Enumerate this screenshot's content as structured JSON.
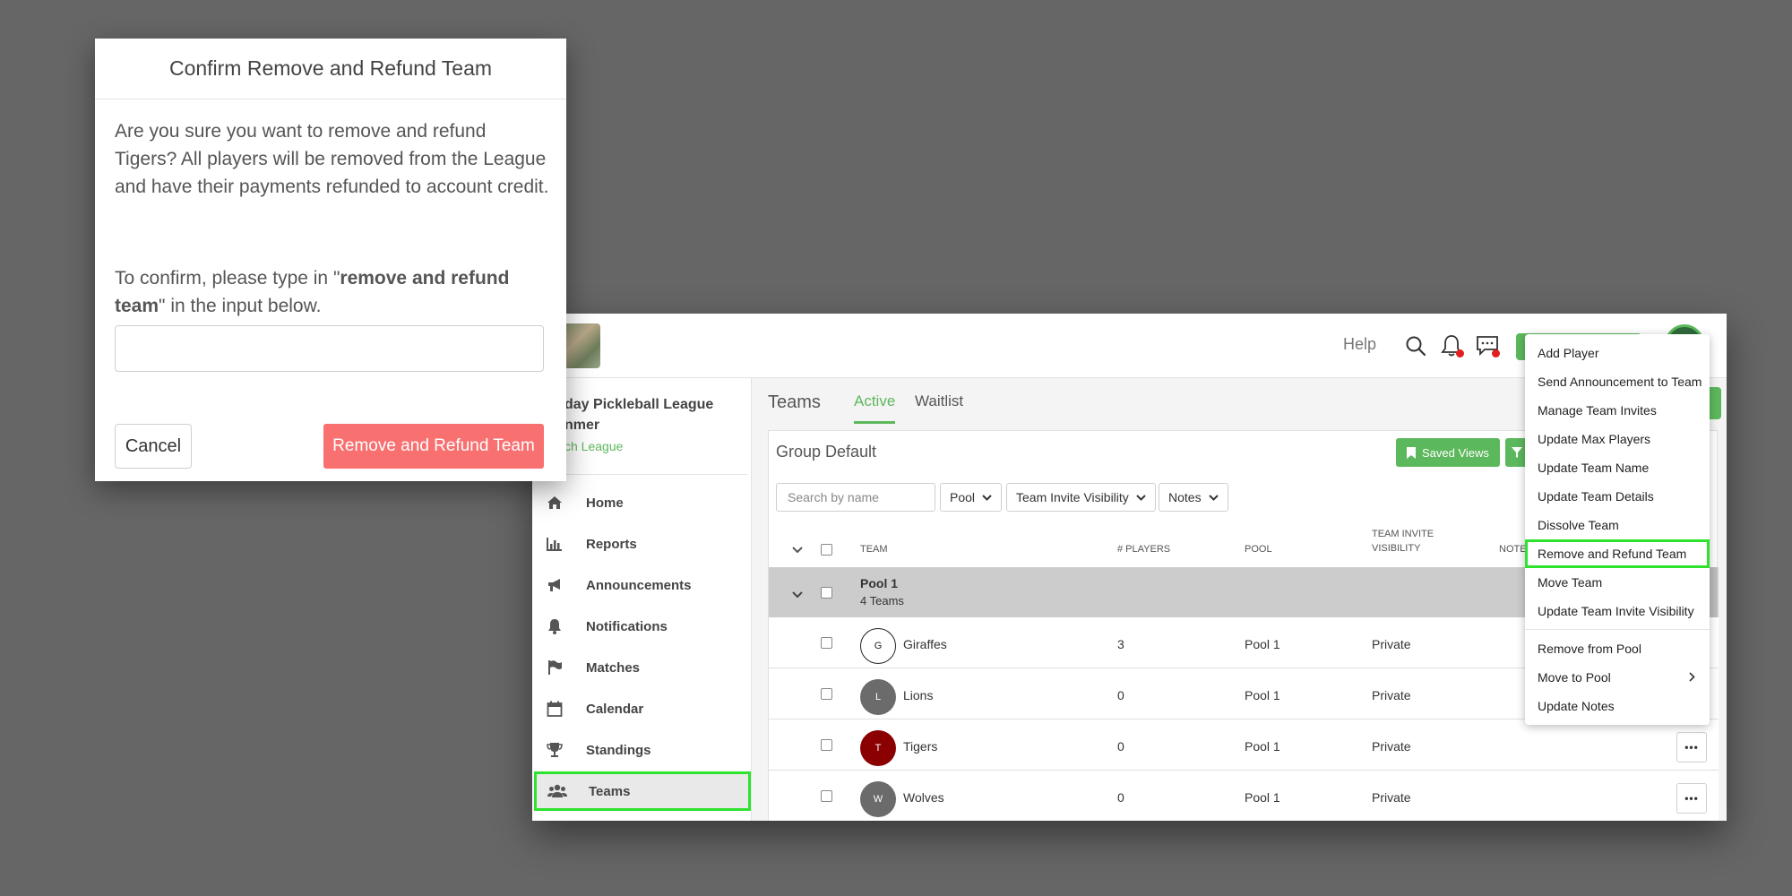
{
  "topbar": {
    "help_label": "Help",
    "icons": [
      "search-icon",
      "bell-icon",
      "chat-icon"
    ],
    "notification_dot_color": "#e02020"
  },
  "sidebar": {
    "league_name_line1": "day Pickleball League",
    "league_name_line2": "nmer",
    "league_link": "ch League",
    "items": [
      {
        "label": "Home",
        "icon": "home-icon"
      },
      {
        "label": "Reports",
        "icon": "bar-chart-icon"
      },
      {
        "label": "Announcements",
        "icon": "megaphone-icon"
      },
      {
        "label": "Notifications",
        "icon": "bell-icon"
      },
      {
        "label": "Matches",
        "icon": "flag-icon"
      },
      {
        "label": "Calendar",
        "icon": "calendar-icon"
      },
      {
        "label": "Standings",
        "icon": "trophy-icon"
      },
      {
        "label": "Teams",
        "icon": "users-icon",
        "active": true
      }
    ]
  },
  "main": {
    "title": "Teams",
    "tabs": [
      {
        "label": "Active",
        "active": true
      },
      {
        "label": "Waitlist",
        "active": false
      }
    ],
    "group_title": "Group Default",
    "saved_views_label": "Saved Views",
    "search_placeholder": "Search by name",
    "filters": [
      "Pool",
      "Team Invite Visibility",
      "Notes"
    ],
    "columns": {
      "team": "TEAM",
      "players": "# PLAYERS",
      "pool": "POOL",
      "visibility_line1": "TEAM INVITE",
      "visibility_line2": "VISIBILITY",
      "notes": "NOTE"
    },
    "pool_group": {
      "name": "Pool 1",
      "count": "4 Teams"
    },
    "teams": [
      {
        "initial": "G",
        "name": "Giraffes",
        "players": "3",
        "pool": "Pool 1",
        "visibility": "Private",
        "avatar_color": "#ffffff"
      },
      {
        "initial": "L",
        "name": "Lions",
        "players": "0",
        "pool": "Pool 1",
        "visibility": "Private",
        "avatar_color": "#6b6b6b"
      },
      {
        "initial": "T",
        "name": "Tigers",
        "players": "0",
        "pool": "Pool 1",
        "visibility": "Private",
        "avatar_color": "#8b0000"
      },
      {
        "initial": "W",
        "name": "Wolves",
        "players": "0",
        "pool": "Pool 1",
        "visibility": "Private",
        "avatar_color": "#6b6b6b"
      }
    ]
  },
  "menu": {
    "items": [
      "Add Player",
      "Send Announcement to Team",
      "Manage Team Invites",
      "Update Max Players",
      "Update Team Name",
      "Update Team Details",
      "Dissolve Team",
      "Remove and Refund Team",
      "Move Team",
      "Update Team Invite Visibility"
    ],
    "items_2": [
      "Remove from Pool",
      "Move to Pool",
      "Update Notes"
    ],
    "highlighted": "Remove and Refund Team"
  },
  "modal": {
    "title": "Confirm Remove and Refund Team",
    "body": "Are you sure you want to remove and refund Tigers? All players will be removed from the League and have their payments refunded to account credit.",
    "confirm_prefix": "To confirm, please type in \"",
    "confirm_phrase": "remove and refund team",
    "confirm_suffix": "\" in the input below.",
    "input_value": "",
    "cancel_label": "Cancel",
    "remove_label": "Remove and Refund Team"
  },
  "colors": {
    "accent": "#5cb85c",
    "danger": "#f87070",
    "highlight": "#2ee22e",
    "backdrop": "#666666"
  }
}
